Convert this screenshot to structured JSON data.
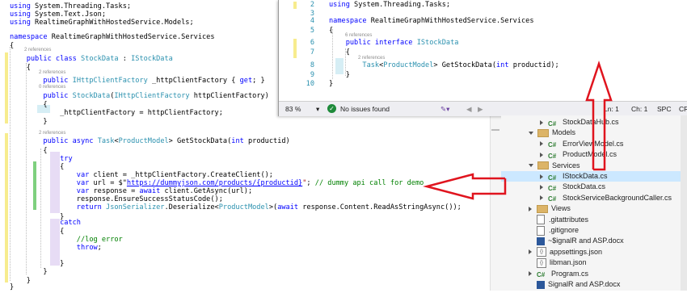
{
  "main_editor": {
    "lines": [
      {
        "parts": [
          {
            "c": "kw",
            "t": "using"
          },
          {
            "c": "",
            "t": " System.Threading.Tasks;"
          }
        ]
      },
      {
        "parts": [
          {
            "c": "kw",
            "t": "using"
          },
          {
            "c": "",
            "t": " System.Text.Json;"
          }
        ]
      },
      {
        "parts": [
          {
            "c": "kw",
            "t": "using"
          },
          {
            "c": "",
            "t": " RealtimeGraphWithHostedService.Models;"
          }
        ]
      },
      {
        "parts": []
      },
      {
        "parts": [
          {
            "c": "kw",
            "t": "namespace"
          },
          {
            "c": "",
            "t": " RealtimeGraphWithHostedService.Services"
          }
        ]
      },
      {
        "parts": [
          {
            "c": "",
            "t": "{"
          }
        ]
      },
      {
        "parts": [
          {
            "c": "",
            "t": "    "
          },
          {
            "c": "kw",
            "t": "public class"
          },
          {
            "c": "",
            "t": " "
          },
          {
            "c": "ty",
            "t": "StockData"
          },
          {
            "c": "",
            "t": " : "
          },
          {
            "c": "ty",
            "t": "IStockData"
          }
        ]
      },
      {
        "parts": [
          {
            "c": "",
            "t": "    {"
          }
        ]
      },
      {
        "parts": [
          {
            "c": "",
            "t": "        "
          },
          {
            "c": "kw",
            "t": "public"
          },
          {
            "c": "",
            "t": " "
          },
          {
            "c": "ty",
            "t": "IHttpClientFactory"
          },
          {
            "c": "",
            "t": " _httpClientFactory { "
          },
          {
            "c": "kw",
            "t": "get"
          },
          {
            "c": "",
            "t": "; }"
          }
        ]
      },
      {
        "parts": [
          {
            "c": "",
            "t": "        "
          },
          {
            "c": "kw",
            "t": "public"
          },
          {
            "c": "",
            "t": " "
          },
          {
            "c": "ty",
            "t": "StockData"
          },
          {
            "c": "",
            "t": "("
          },
          {
            "c": "ty",
            "t": "IHttpClientFactory"
          },
          {
            "c": "",
            "t": " httpClientFactory)"
          }
        ]
      },
      {
        "parts": [
          {
            "c": "",
            "t": "        {"
          }
        ]
      },
      {
        "parts": [
          {
            "c": "",
            "t": "            _httpClientFactory = httpClientFactory;"
          }
        ]
      },
      {
        "parts": [
          {
            "c": "",
            "t": "        }"
          }
        ]
      },
      {
        "parts": []
      },
      {
        "parts": [
          {
            "c": "",
            "t": "        "
          },
          {
            "c": "kw",
            "t": "public async"
          },
          {
            "c": "",
            "t": " "
          },
          {
            "c": "ty",
            "t": "Task"
          },
          {
            "c": "",
            "t": "<"
          },
          {
            "c": "ty",
            "t": "ProductModel"
          },
          {
            "c": "",
            "t": "> GetStockData("
          },
          {
            "c": "kw",
            "t": "int"
          },
          {
            "c": "",
            "t": " productid)"
          }
        ]
      },
      {
        "parts": [
          {
            "c": "",
            "t": "        {"
          }
        ]
      },
      {
        "parts": [
          {
            "c": "",
            "t": "            "
          },
          {
            "c": "kw",
            "t": "try"
          }
        ]
      },
      {
        "parts": [
          {
            "c": "",
            "t": "            {"
          }
        ]
      },
      {
        "parts": [
          {
            "c": "",
            "t": "                "
          },
          {
            "c": "kw",
            "t": "var"
          },
          {
            "c": "",
            "t": " client = _httpClientFactory.CreateClient();"
          }
        ]
      },
      {
        "parts": [
          {
            "c": "",
            "t": "                "
          },
          {
            "c": "kw",
            "t": "var"
          },
          {
            "c": "",
            "t": " url = $\""
          },
          {
            "c": "ul",
            "t": "https://dummyjson.com/products/{productid}"
          },
          {
            "c": "st",
            "t": "\""
          },
          {
            "c": "",
            "t": "; "
          },
          {
            "c": "cm",
            "t": "// dummy api call for demo"
          }
        ]
      },
      {
        "parts": [
          {
            "c": "",
            "t": "                "
          },
          {
            "c": "kw",
            "t": "var"
          },
          {
            "c": "",
            "t": " response = "
          },
          {
            "c": "kw",
            "t": "await"
          },
          {
            "c": "",
            "t": " client.GetAsync(url);"
          }
        ]
      },
      {
        "parts": [
          {
            "c": "",
            "t": "                response.EnsureSuccessStatusCode();"
          }
        ]
      },
      {
        "parts": [
          {
            "c": "",
            "t": "                "
          },
          {
            "c": "kw",
            "t": "return"
          },
          {
            "c": "",
            "t": " "
          },
          {
            "c": "ty",
            "t": "JsonSerializer"
          },
          {
            "c": "",
            "t": ".Deserialize<"
          },
          {
            "c": "ty",
            "t": "ProductModel"
          },
          {
            "c": "",
            "t": ">("
          },
          {
            "c": "kw",
            "t": "await"
          },
          {
            "c": "",
            "t": " response.Content.ReadAsStringAsync());"
          }
        ]
      },
      {
        "parts": [
          {
            "c": "",
            "t": "            }"
          }
        ]
      },
      {
        "parts": [
          {
            "c": "",
            "t": "            "
          },
          {
            "c": "kw",
            "t": "catch"
          }
        ]
      },
      {
        "parts": [
          {
            "c": "",
            "t": "            {"
          }
        ]
      },
      {
        "parts": [
          {
            "c": "",
            "t": "                "
          },
          {
            "c": "cm",
            "t": "//log error"
          }
        ]
      },
      {
        "parts": [
          {
            "c": "",
            "t": "                "
          },
          {
            "c": "kw",
            "t": "throw"
          },
          {
            "c": "",
            "t": ";"
          }
        ]
      },
      {
        "parts": []
      },
      {
        "parts": [
          {
            "c": "",
            "t": "            }"
          }
        ]
      },
      {
        "parts": [
          {
            "c": "",
            "t": "        }"
          }
        ]
      },
      {
        "parts": [
          {
            "c": "",
            "t": "    }"
          }
        ]
      },
      {
        "parts": [
          {
            "c": "",
            "t": "}"
          }
        ]
      }
    ],
    "refs": {
      "class_refs": "2 references",
      "prop_refs": "2 references",
      "ctor_refs": "0 references",
      "method_refs": "2 references"
    }
  },
  "float_editor": {
    "lines": [
      {
        "num": "2",
        "parts": [
          {
            "c": "kw",
            "t": "using"
          },
          {
            "c": "",
            "t": " System.Threading.Tasks;"
          }
        ]
      },
      {
        "num": "3",
        "parts": []
      },
      {
        "num": "4",
        "parts": [
          {
            "c": "kw",
            "t": "namespace"
          },
          {
            "c": "",
            "t": " RealtimeGraphWithHostedService.Services"
          }
        ]
      },
      {
        "num": "5",
        "parts": [
          {
            "c": "",
            "t": "{"
          }
        ]
      },
      {
        "num": "6",
        "parts": [
          {
            "c": "",
            "t": "    "
          },
          {
            "c": "kw",
            "t": "public interface"
          },
          {
            "c": "",
            "t": " "
          },
          {
            "c": "ty",
            "t": "IStockData"
          }
        ]
      },
      {
        "num": "7",
        "parts": [
          {
            "c": "",
            "t": "    {"
          }
        ]
      },
      {
        "num": "8",
        "parts": [
          {
            "c": "",
            "t": "        "
          },
          {
            "c": "ty",
            "t": "Task"
          },
          {
            "c": "",
            "t": "<"
          },
          {
            "c": "ty",
            "t": "ProductModel"
          },
          {
            "c": "",
            "t": "> GetStockData("
          },
          {
            "c": "kw",
            "t": "int"
          },
          {
            "c": "",
            "t": " productid);"
          }
        ]
      },
      {
        "num": "9",
        "parts": [
          {
            "c": "",
            "t": "    }"
          }
        ]
      },
      {
        "num": "10",
        "parts": [
          {
            "c": "",
            "t": "}"
          }
        ]
      }
    ],
    "refs": {
      "interface_refs": "6 references",
      "method_refs": "2 references"
    },
    "status": {
      "zoom": "83 %",
      "issues": "No issues found",
      "ln": "Ln: 1",
      "ch": "Ch: 1",
      "spc": "SPC",
      "crlf": "CR"
    }
  },
  "solution_explorer": {
    "items": [
      {
        "indent": 1,
        "type": "cs",
        "arrow": "right",
        "label": "StockDataHub.cs",
        "sel": false
      },
      {
        "indent": 0,
        "type": "folder",
        "arrow": "down",
        "label": "Models",
        "sel": false
      },
      {
        "indent": 1,
        "type": "cs",
        "arrow": "right",
        "label": "ErrorViewModel.cs",
        "sel": false
      },
      {
        "indent": 1,
        "type": "cs",
        "arrow": "right",
        "label": "ProductModel.cs",
        "sel": false
      },
      {
        "indent": 0,
        "type": "folder",
        "arrow": "down",
        "label": "Services",
        "sel": false
      },
      {
        "indent": 1,
        "type": "cs",
        "arrow": "right",
        "label": "IStockData.cs",
        "sel": true
      },
      {
        "indent": 1,
        "type": "cs",
        "arrow": "right",
        "label": "StockData.cs",
        "sel": false
      },
      {
        "indent": 1,
        "type": "cs",
        "arrow": "right",
        "label": "StockServiceBackgroundCaller.cs",
        "sel": false
      },
      {
        "indent": 0,
        "type": "folder",
        "arrow": "right",
        "label": "Views",
        "sel": false
      },
      {
        "indent": 0,
        "type": "file",
        "arrow": "",
        "label": ".gitattributes",
        "sel": false
      },
      {
        "indent": 0,
        "type": "file",
        "arrow": "",
        "label": ".gitignore",
        "sel": false
      },
      {
        "indent": 0,
        "type": "word",
        "arrow": "",
        "label": "~$ignalR and ASP.docx",
        "sel": false
      },
      {
        "indent": 0,
        "type": "json",
        "arrow": "right",
        "label": "appsettings.json",
        "sel": false
      },
      {
        "indent": 0,
        "type": "json",
        "arrow": "",
        "label": "libman.json",
        "sel": false
      },
      {
        "indent": 0,
        "type": "cs",
        "arrow": "right",
        "label": "Program.cs",
        "sel": false
      },
      {
        "indent": 0,
        "type": "word",
        "arrow": "",
        "label": "SignalR and ASP.docx",
        "sel": false
      }
    ],
    "cs_glyph": "C#"
  },
  "colors": {
    "arrow": "#e0141e",
    "selection": "#cce8ff",
    "keyword": "#0000ff",
    "type": "#2b91af"
  }
}
